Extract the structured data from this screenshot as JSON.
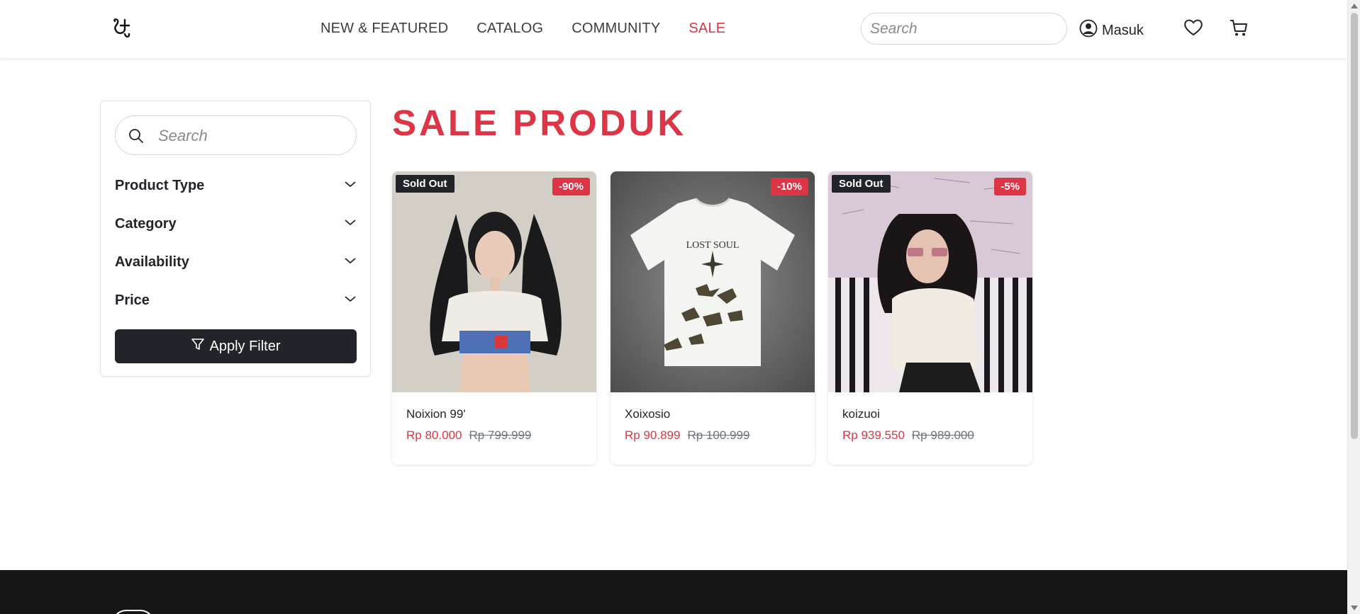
{
  "header": {
    "logo_icon": "brand-logo-icon",
    "nav": [
      {
        "label": "NEW & FEATURED"
      },
      {
        "label": "CATALOG"
      },
      {
        "label": "COMMUNITY"
      },
      {
        "label": "SALE"
      }
    ],
    "search_placeholder": "Search",
    "login_label": "Masuk",
    "icons": {
      "user": "user-circle-icon",
      "wishlist": "heart-icon",
      "cart": "cart-icon"
    }
  },
  "sidebar": {
    "search_placeholder": "Search",
    "filters": [
      {
        "label": "Product Type"
      },
      {
        "label": "Category"
      },
      {
        "label": "Availability"
      },
      {
        "label": "Price"
      }
    ],
    "apply_label": "Apply Filter"
  },
  "main": {
    "title": "SALE PRODUK",
    "products": [
      {
        "name": "Noixion 99'",
        "price": "Rp 80.000",
        "old_price": "Rp 799.999",
        "discount": "-90%",
        "sold_out": "Sold Out"
      },
      {
        "name": "Xoixosio",
        "price": "Rp 90.899",
        "old_price": "Rp 100.999",
        "discount": "-10%",
        "sold_out": ""
      },
      {
        "name": "koizuoi",
        "price": "Rp 939.550",
        "old_price": "Rp 989.000",
        "discount": "-5%",
        "sold_out": "Sold Out"
      }
    ]
  },
  "colors": {
    "accent": "#dc3545",
    "dark": "#212529",
    "footer": "#161616"
  }
}
